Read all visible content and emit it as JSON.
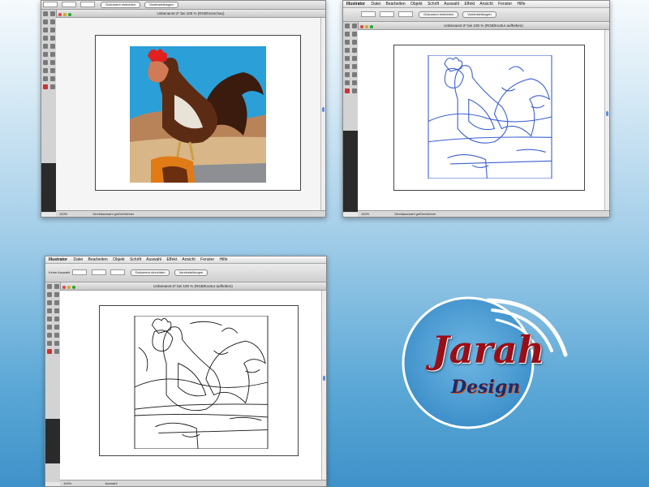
{
  "screenshot_1": {
    "title": "Unbenannt-2* bei 100 % (RGB/Vorschau)",
    "status": "Direktauswahl größer/kleiner",
    "zoom": "100%",
    "options": [
      "Dokument einrichten",
      "Voreinstellungen"
    ]
  },
  "screenshot_2": {
    "title": "Unbenannt-2* bei 100 % (RGB/Kontur aufheben)",
    "status": "Direktauswahl größer/kleiner",
    "zoom": "100%",
    "options": [
      "Dokument einrichten",
      "Voreinstellungen"
    ],
    "menu": [
      "Illustrator",
      "Datei",
      "Bearbeiten",
      "Objekt",
      "Schrift",
      "Auswahl",
      "Effekt",
      "Ansicht",
      "Fenster",
      "Hilfe"
    ]
  },
  "screenshot_3": {
    "title": "Unbenannt-2* bei 100 % (RGB/Kontur aufheben)",
    "status": "Auswahl",
    "zoom": "100%",
    "options": [
      "Dokument einrichten",
      "Voreinstellungen"
    ],
    "menu": [
      "Illustrator",
      "Datei",
      "Bearbeiten",
      "Objekt",
      "Schrift",
      "Auswahl",
      "Effekt",
      "Ansicht",
      "Fenster",
      "Hilfe"
    ],
    "selection": "Keine Auswahl"
  },
  "logo": {
    "name": "Jarah",
    "sub": "Design"
  },
  "colors": {
    "sky": "#2a9fd8",
    "trace_blue": "#3b5fd0",
    "logo_red": "#9b0d14",
    "logo_navy": "#1c2a6b"
  }
}
